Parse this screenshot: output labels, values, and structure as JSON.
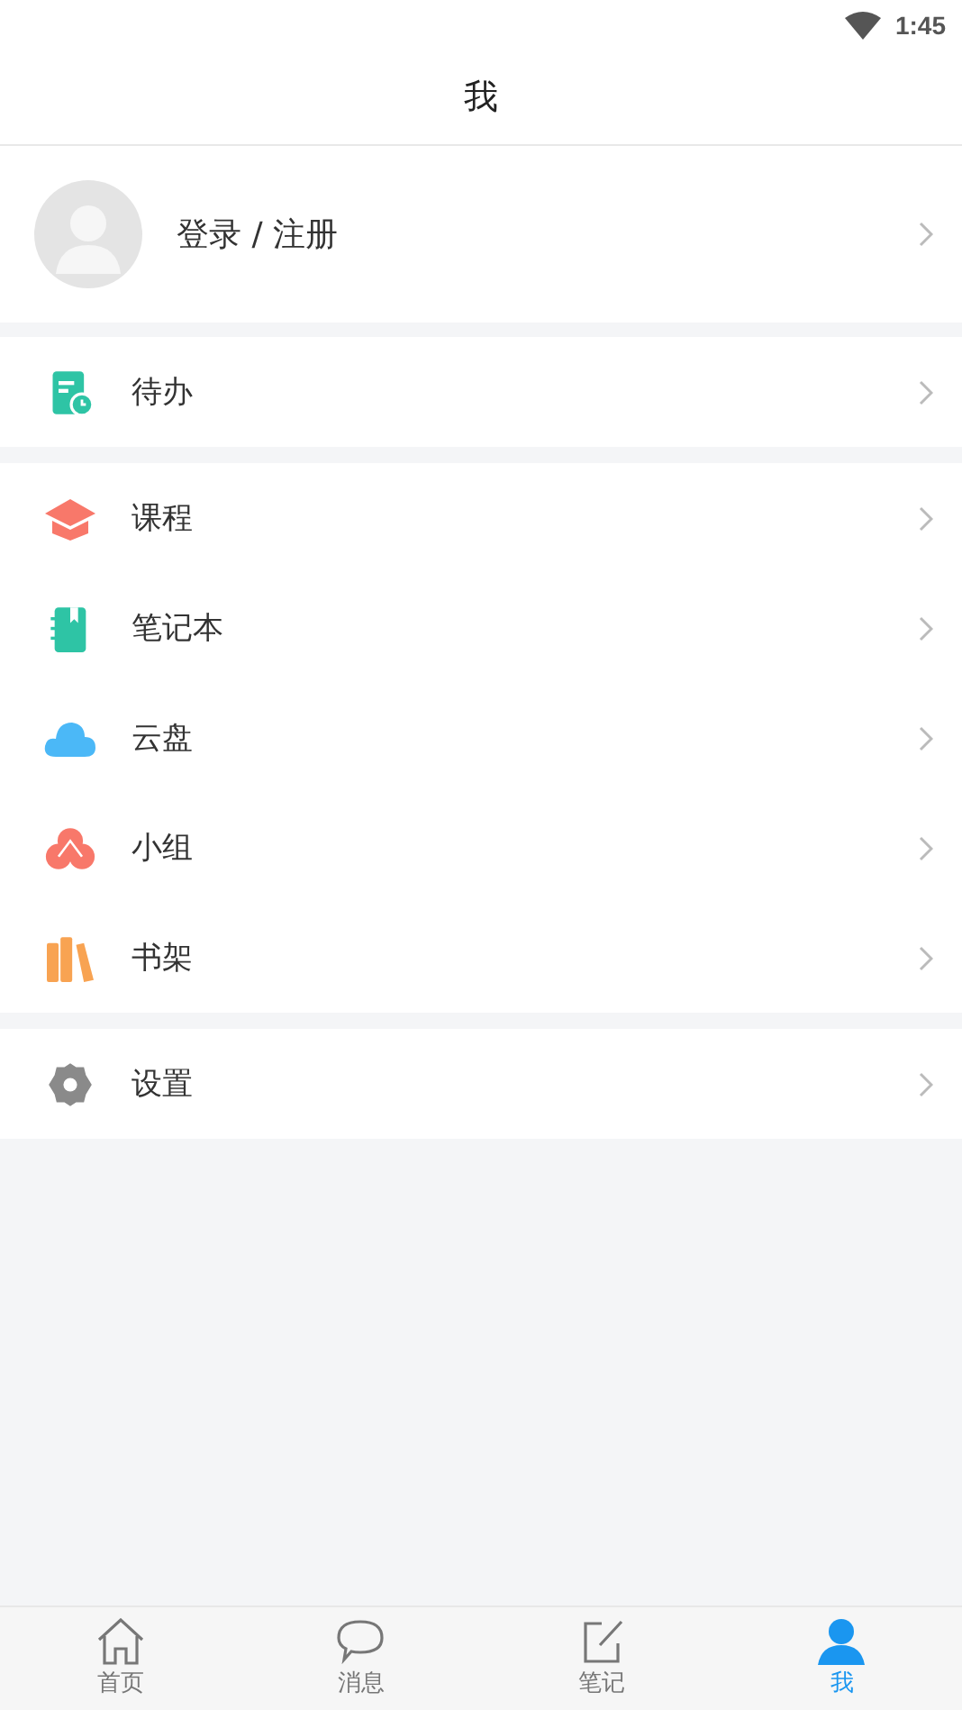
{
  "status_bar": {
    "time": "1:45"
  },
  "header": {
    "title": "我"
  },
  "profile": {
    "label": "登录 / 注册"
  },
  "groups": [
    {
      "items": [
        {
          "kind": "todo",
          "label": "待办"
        }
      ]
    },
    {
      "items": [
        {
          "kind": "course",
          "label": "课程"
        },
        {
          "kind": "notebook",
          "label": "笔记本"
        },
        {
          "kind": "cloud",
          "label": "云盘"
        },
        {
          "kind": "group",
          "label": "小组"
        },
        {
          "kind": "bookshelf",
          "label": "书架"
        }
      ]
    },
    {
      "items": [
        {
          "kind": "settings",
          "label": "设置"
        }
      ]
    }
  ],
  "tab_bar": [
    {
      "kind": "home",
      "label": "首页",
      "selected": false
    },
    {
      "kind": "message",
      "label": "消息",
      "selected": false
    },
    {
      "kind": "note",
      "label": "笔记",
      "selected": false
    },
    {
      "kind": "me",
      "label": "我",
      "selected": true
    }
  ]
}
